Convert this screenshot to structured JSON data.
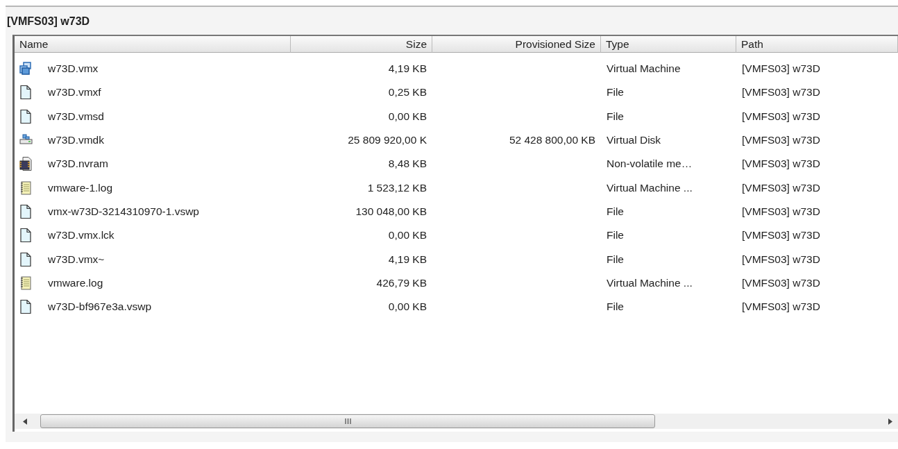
{
  "panel": {
    "title": "[VMFS03] w73D"
  },
  "table": {
    "columns": [
      {
        "label": "Name",
        "kind": "text"
      },
      {
        "label": "Size",
        "kind": "number"
      },
      {
        "label": "Provisioned Size",
        "kind": "number"
      },
      {
        "label": "Type",
        "kind": "text"
      },
      {
        "label": "Path",
        "kind": "text"
      }
    ],
    "rows": [
      {
        "kind": "vm",
        "cells": [
          "w73D.vmx",
          "4,19 KB",
          "",
          "Virtual Machine",
          "[VMFS03] w73D"
        ]
      },
      {
        "kind": "file",
        "cells": [
          "w73D.vmxf",
          "0,25 KB",
          "",
          "File",
          "[VMFS03] w73D"
        ]
      },
      {
        "kind": "file",
        "cells": [
          "w73D.vmsd",
          "0,00 KB",
          "",
          "File",
          "[VMFS03] w73D"
        ]
      },
      {
        "kind": "disk",
        "cells": [
          "w73D.vmdk",
          "25 809 920,00 K",
          "52 428 800,00 KB",
          "Virtual Disk",
          "[VMFS03] w73D"
        ]
      },
      {
        "kind": "nvram",
        "cells": [
          "w73D.nvram",
          "8,48 KB",
          "",
          "Non-volatile me…",
          "[VMFS03] w73D"
        ]
      },
      {
        "kind": "log",
        "cells": [
          "vmware-1.log",
          "1 523,12 KB",
          "",
          "Virtual Machine ...",
          "[VMFS03] w73D"
        ]
      },
      {
        "kind": "file",
        "cells": [
          "vmx-w73D-3214310970-1.vswp",
          "130 048,00 KB",
          "",
          "File",
          "[VMFS03] w73D"
        ]
      },
      {
        "kind": "file",
        "cells": [
          "w73D.vmx.lck",
          "0,00 KB",
          "",
          "File",
          "[VMFS03] w73D"
        ]
      },
      {
        "kind": "file",
        "cells": [
          "w73D.vmx~",
          "4,19 KB",
          "",
          "File",
          "[VMFS03] w73D"
        ]
      },
      {
        "kind": "log",
        "cells": [
          "vmware.log",
          "426,79 KB",
          "",
          "Virtual Machine ...",
          "[VMFS03] w73D"
        ]
      },
      {
        "kind": "file",
        "cells": [
          "w73D-bf967e3a.vswp",
          "0,00 KB",
          "",
          "File",
          "[VMFS03] w73D"
        ]
      }
    ]
  }
}
